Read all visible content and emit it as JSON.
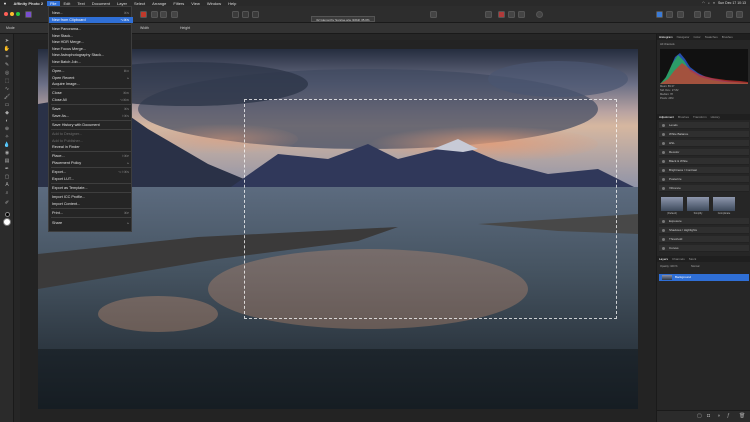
{
  "menubar": {
    "app": "Affinity Photo 2",
    "items": [
      "File",
      "Edit",
      "Text",
      "Document",
      "Layer",
      "Select",
      "Arrange",
      "Filters",
      "View",
      "Window",
      "Help"
    ],
    "clock": "Sun Dec 17  10:13"
  },
  "document": {
    "tab_title": "02 Glenorchy Sunrise.arw (16bit) 35.0%"
  },
  "context": {
    "mode": "Mode",
    "width": "Width",
    "height": "Height"
  },
  "file_menu": {
    "items": [
      {
        "label": "New...",
        "shortcut": "⌘N"
      },
      {
        "label": "New from Clipboard",
        "shortcut": "⌥⌘N",
        "highlight": true
      },
      {
        "label": "New Panorama..."
      },
      {
        "label": "New Stack..."
      },
      {
        "label": "New HDR Merge..."
      },
      {
        "label": "New Focus Merge..."
      },
      {
        "label": "New Astrophotography Stack..."
      },
      {
        "label": "New Batch Job..."
      },
      {
        "label": "Open...",
        "shortcut": "⌘O"
      },
      {
        "label": "Open Recent"
      },
      {
        "label": "Acquire Image..."
      },
      {
        "label": "Close",
        "shortcut": "⌘W"
      },
      {
        "label": "Close All",
        "shortcut": "⌥⌘W"
      },
      {
        "label": "Save",
        "shortcut": "⌘S"
      },
      {
        "label": "Save As...",
        "shortcut": "⇧⌘S"
      },
      {
        "label": "Save History with Document"
      },
      {
        "label": "Add to Designer...",
        "dim": true
      },
      {
        "label": "Add to Publisher...",
        "dim": true
      },
      {
        "label": "Reveal in Finder"
      },
      {
        "label": "Place...",
        "shortcut": "⇧⌘P"
      },
      {
        "label": "Placement Policy"
      },
      {
        "label": "Export...",
        "shortcut": "⌥⇧⌘S"
      },
      {
        "label": "Export LUT..."
      },
      {
        "label": "Export as Template..."
      },
      {
        "label": "Import ICC Profile..."
      },
      {
        "label": "Import Content..."
      },
      {
        "label": "Print...",
        "shortcut": "⌘P"
      },
      {
        "label": "Share"
      }
    ]
  },
  "panels": {
    "top_tabs": [
      "Histogram",
      "Navigator",
      "Color",
      "Swatches",
      "Brushes",
      "Channels"
    ],
    "histogram_option": "All Channels",
    "histogram_stats": [
      "Mean: 89.37",
      "Std. Dev.: 27.82",
      "Median: 78",
      "Pixels: 24M"
    ],
    "adjustment_tabs": [
      "Adjustment",
      "Brushes",
      "Transform",
      "History"
    ],
    "adjustments": [
      "Levels",
      "White Balance",
      "HSL",
      "Recolor",
      "Black & White",
      "Brightness / Contrast",
      "Posterize",
      "Vibrance"
    ],
    "presets": [
      "(Default)",
      "Simplify",
      "Complicate"
    ],
    "adjustments_2": [
      "Exposure",
      "Shadows / Highlights",
      "Threshold",
      "Curves"
    ],
    "layer_tabs": [
      "Layers",
      "Channels",
      "Stock"
    ],
    "opacity": "Opacity: 100 %",
    "blend": "Normal",
    "layer_name": "Background"
  }
}
